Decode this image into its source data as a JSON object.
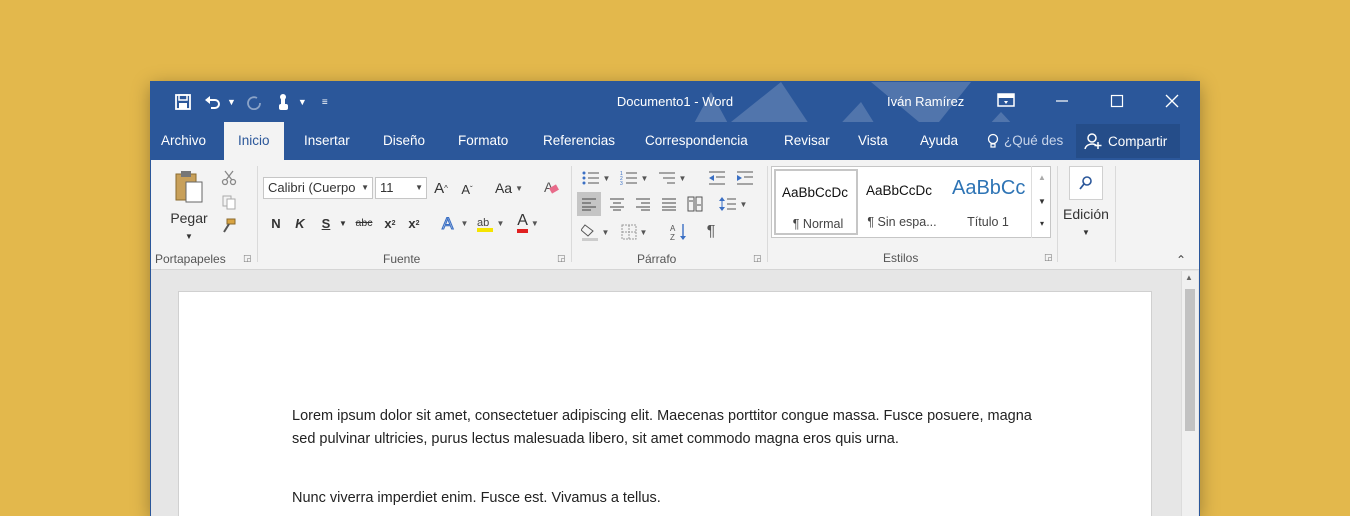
{
  "titlebar": {
    "document_title": "Documento1",
    "separator": "-",
    "app_name": "Word",
    "user_name": "Iván Ramírez",
    "qat": {
      "save_icon": "save-icon",
      "undo_icon": "undo-icon",
      "redo_icon": "redo-icon",
      "touch_mode_icon": "touch-mouse-mode-icon",
      "customize_icon": "customize-qat-icon"
    }
  },
  "tabs": [
    "Archivo",
    "Inicio",
    "Insertar",
    "Diseño",
    "Formato",
    "Referencias",
    "Correspondencia",
    "Revisar",
    "Vista",
    "Ayuda"
  ],
  "active_tab": "Inicio",
  "tell_me": "¿Qué des",
  "share_label": "Compartir",
  "ribbon": {
    "clipboard": {
      "paste_label": "Pegar",
      "group_label": "Portapapeles"
    },
    "font": {
      "font_name": "Calibri (Cuerpo",
      "font_size": "11",
      "case_label": "Aa",
      "bold": "N",
      "italic": "K",
      "underline": "S",
      "strike": "abc",
      "subscript": "x",
      "superscript": "x",
      "font_color_letter": "A",
      "group_label": "Fuente"
    },
    "paragraph": {
      "group_label": "Párrafo",
      "pilcrow": "¶"
    },
    "styles": {
      "items": [
        {
          "sample": "AaBbCcDc",
          "name": "¶ Normal"
        },
        {
          "sample": "AaBbCcDc",
          "name": "¶ Sin espa..."
        },
        {
          "sample": "AaBbCc",
          "name": "Título 1"
        }
      ],
      "group_label": "Estilos"
    },
    "editing": {
      "label": "Edición"
    }
  },
  "document": {
    "paragraphs": [
      "Lorem ipsum dolor sit amet, consectetuer adipiscing elit. Maecenas porttitor congue massa. Fusce posuere, magna sed pulvinar ultricies, purus lectus malesuada libero, sit amet commodo magna eros quis urna.",
      "Nunc viverra imperdiet enim. Fusce est. Vivamus a tellus."
    ]
  },
  "colors": {
    "background": "#e3b84c",
    "word_blue": "#2b579a",
    "ribbon_bg": "#f3f3f3"
  }
}
